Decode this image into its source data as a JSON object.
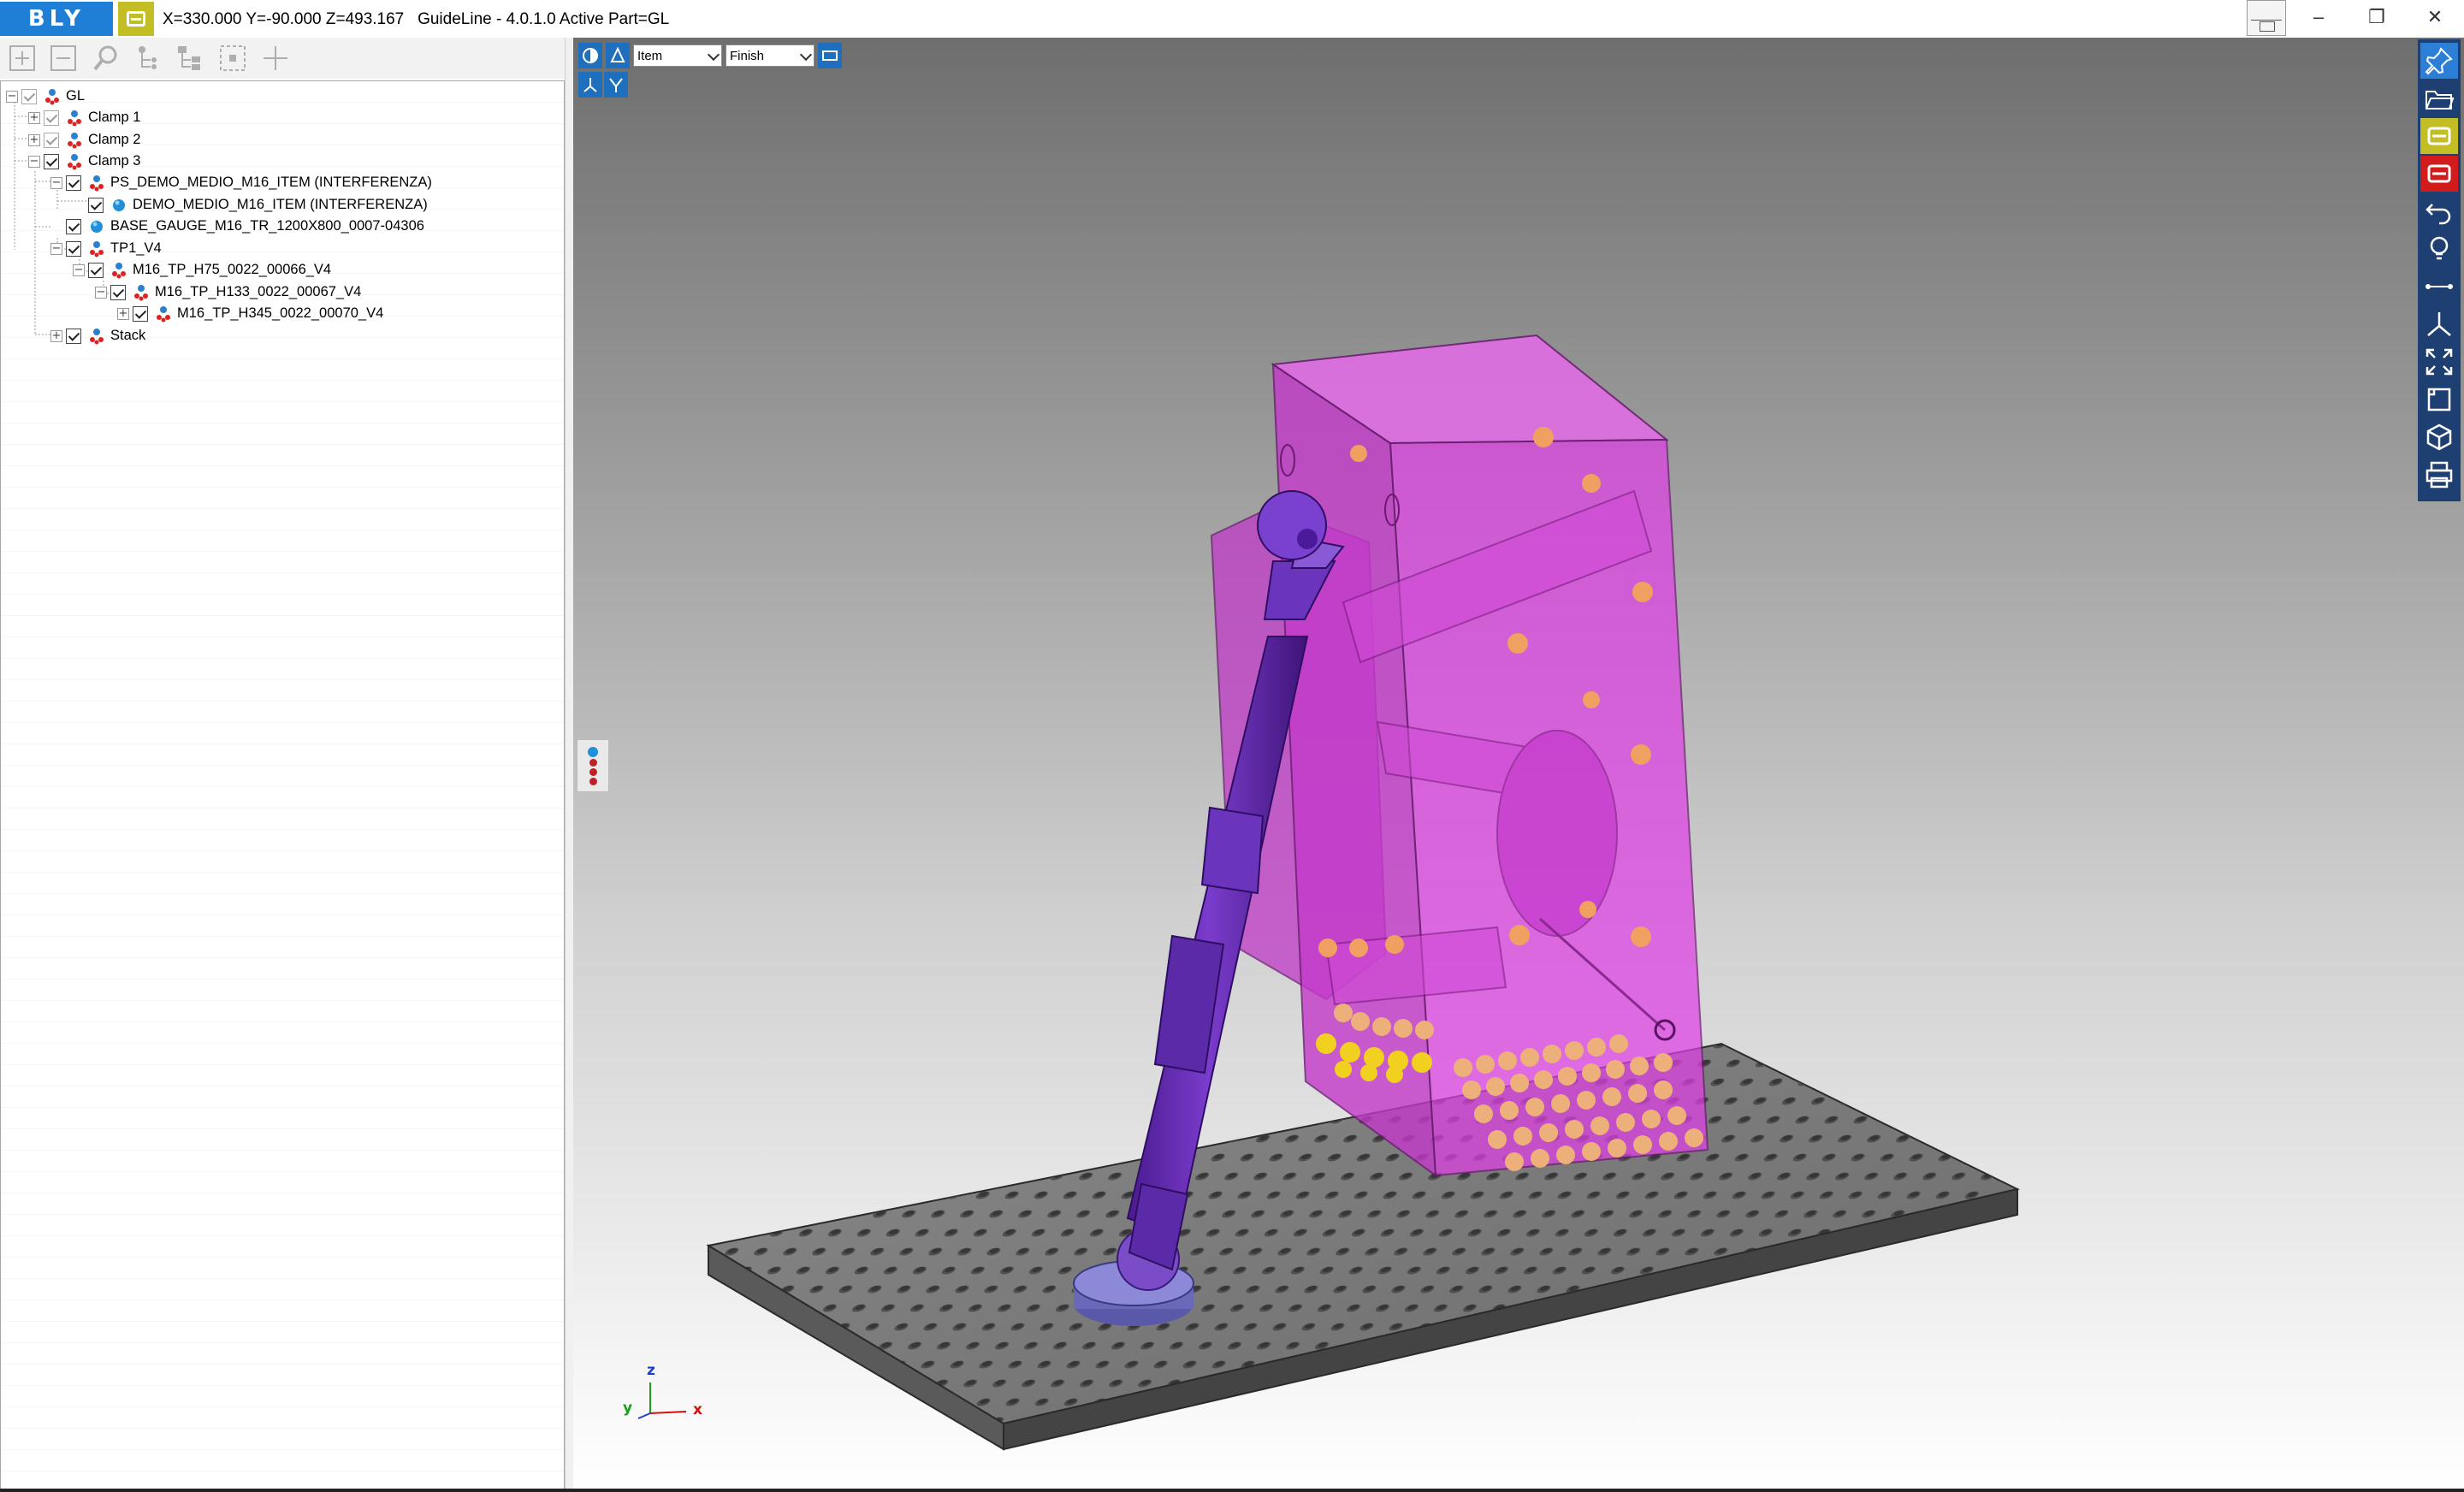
{
  "titlebar": {
    "brand": "BLY",
    "status": "X=330.000 Y=-90.000 Z=493.167   GuideLine - 4.0.1.0 Active Part=GL",
    "minimize": "–",
    "maximize": "❐",
    "close": "✕"
  },
  "tree": {
    "items": [
      {
        "label": "GL"
      },
      {
        "label": "Clamp 1"
      },
      {
        "label": "Clamp 2"
      },
      {
        "label": "Clamp 3"
      },
      {
        "label": "PS_DEMO_MEDIO_M16_ITEM (INTERFERENZA)"
      },
      {
        "label": "DEMO_MEDIO_M16_ITEM (INTERFERENZA)"
      },
      {
        "label": "BASE_GAUGE_M16_TR_1200X800_0007-04306"
      },
      {
        "label": "TP1_V4"
      },
      {
        "label": "M16_TP_H75_0022_00066_V4"
      },
      {
        "label": "M16_TP_H133_0022_00067_V4"
      },
      {
        "label": "M16_TP_H345_0022_00070_V4"
      },
      {
        "label": "Stack"
      }
    ]
  },
  "viewport": {
    "item_select": "Item",
    "finish_select": "Finish",
    "axes": {
      "z": "z",
      "y": "y",
      "x": "x"
    }
  },
  "colors": {
    "accent_blue": "#1f7fd6",
    "brand_yellow": "#c3bd26",
    "toolbar_navy": "#1e3f72",
    "part_magenta": "#d93ad9",
    "clamp_purple": "#6a2fb0",
    "contact_orange": "#f0a060"
  },
  "right_toolbar": {
    "icons": [
      "pin-icon",
      "open-folder-icon",
      "yellow-module-icon",
      "red-module-icon",
      "undo-icon",
      "bulb-icon",
      "measure-icon",
      "axes-icon",
      "fit-view-icon",
      "frame-icon",
      "cube-view-icon",
      "print-icon"
    ]
  }
}
